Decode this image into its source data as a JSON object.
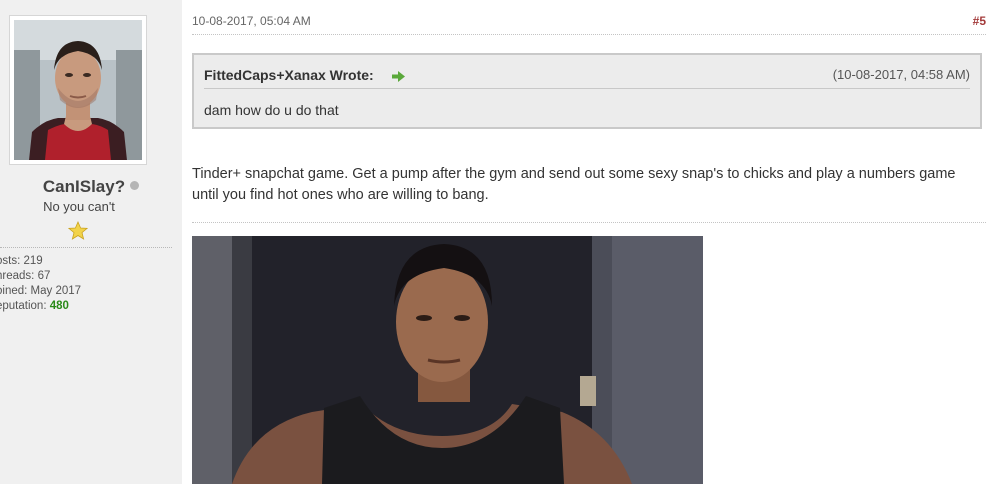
{
  "user": {
    "username": "CanISlay?",
    "user_title": "No you can't",
    "stats": {
      "posts_label": "osts:",
      "posts_value": "219",
      "threads_label": "hreads:",
      "threads_value": "67",
      "joined_label": "oined:",
      "joined_value": "May 2017",
      "reputation_label": "eputation:",
      "reputation_value": "480"
    }
  },
  "post": {
    "date": "10-08-2017, 05:04 AM",
    "number": "#5",
    "quote": {
      "author": "FittedCaps+Xanax Wrote:",
      "time": "(10-08-2017, 04:58 AM)",
      "text": "dam how do u do that"
    },
    "message": "Tinder+ snapchat game. Get a pump after the gym and send out some sexy snap's to chicks and play a numbers game until you find hot ones who are willing to bang."
  },
  "colors": {
    "post_number": "#a33a3a",
    "reputation": "#2a8a18",
    "status_offline": "#b5b5b5",
    "quote_bg": "#ececec",
    "sidebar_bg": "#f0f0f0"
  },
  "icons": {
    "status": "offline-dot-icon",
    "rank": "star-icon",
    "quote_link": "green-arrow-icon"
  }
}
